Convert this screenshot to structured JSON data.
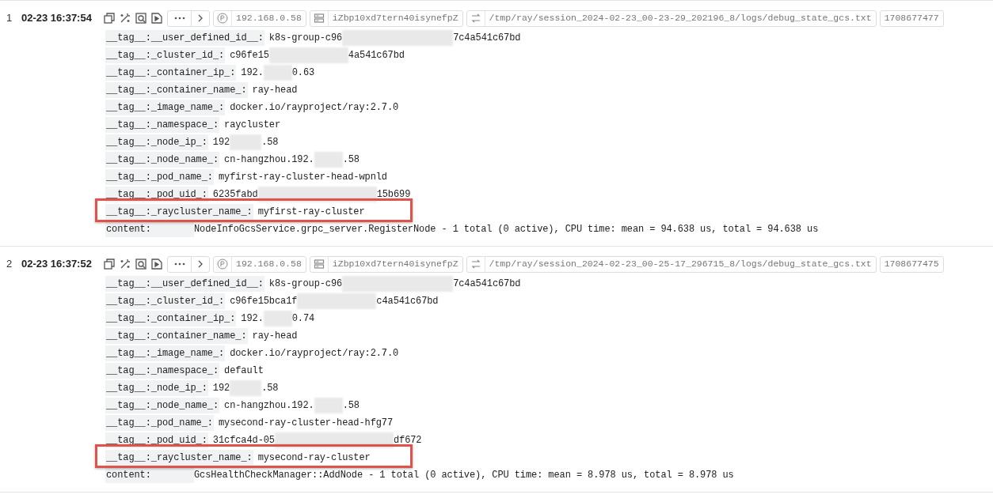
{
  "records": [
    {
      "number": "1",
      "time": "02-23 16:37:54",
      "chips": [
        {
          "kind": "ip",
          "text": "192.168.0.58"
        },
        {
          "kind": "host",
          "text": "iZbp10xd7tern40isynefpZ"
        },
        {
          "kind": "path",
          "text": "/tmp/ray/session_2024-02-23_00-23-29_202196_8/logs/debug_state_gcs.txt"
        },
        {
          "kind": "plain",
          "text": "1708677477"
        }
      ],
      "fields": [
        {
          "key": "__tag__:__user_defined_id__:",
          "value_start": "k8s-group-c96",
          "redacted": true,
          "value_end": "7c4a541c67bd",
          "highlighted": false
        },
        {
          "key": "__tag__:_cluster_id_:",
          "value_start": "c96fe15",
          "redacted": true,
          "value_end": "4a541c67bd",
          "highlighted": false
        },
        {
          "key": "__tag__:_container_ip_:",
          "value_start": "192.",
          "redacted": true,
          "value_end": "0.63",
          "highlighted": false
        },
        {
          "key": "__tag__:_container_name_:",
          "value_start": "ray-head",
          "highlighted": false
        },
        {
          "key": "__tag__:_image_name_:",
          "value_start": "docker.io/rayproject/ray:2.7.0",
          "highlighted": false
        },
        {
          "key": "__tag__:_namespace_:",
          "value_start": "raycluster",
          "highlighted": false
        },
        {
          "key": "__tag__:_node_ip_:",
          "value_start": "192",
          "redacted": true,
          "value_end": ".58",
          "highlighted": false
        },
        {
          "key": "__tag__:_node_name_:",
          "value_start": "cn-hangzhou.192.",
          "redacted": true,
          "value_end": ".58",
          "highlighted": false
        },
        {
          "key": "__tag__:_pod_name_:",
          "value_start": "myfirst-ray-cluster-head-wpnld",
          "highlighted": false
        },
        {
          "key": "__tag__:_pod_uid_:",
          "value_start": "6235fabd",
          "redacted": true,
          "value_end": "15b699",
          "highlighted": false
        },
        {
          "key": "__tag__:_raycluster_name_:",
          "value_start": "myfirst-ray-cluster",
          "highlighted": true
        }
      ],
      "content_key": "content:",
      "content": "NodeInfoGcsService.grpc_server.RegisterNode - 1 total (0 active), CPU time: mean = 94.638 us, total = 94.638 us"
    },
    {
      "number": "2",
      "time": "02-23 16:37:52",
      "chips": [
        {
          "kind": "ip",
          "text": "192.168.0.58"
        },
        {
          "kind": "host",
          "text": "iZbp10xd7tern40isynefpZ"
        },
        {
          "kind": "path",
          "text": "/tmp/ray/session_2024-02-23_00-25-17_296715_8/logs/debug_state_gcs.txt"
        },
        {
          "kind": "plain",
          "text": "1708677475"
        }
      ],
      "fields": [
        {
          "key": "__tag__:__user_defined_id__:",
          "value_start": "k8s-group-c96",
          "redacted": true,
          "value_end": "7c4a541c67bd",
          "highlighted": false
        },
        {
          "key": "__tag__:_cluster_id_:",
          "value_start": "c96fe15bca1f",
          "redacted": true,
          "value_end": "c4a541c67bd",
          "highlighted": false
        },
        {
          "key": "__tag__:_container_ip_:",
          "value_start": "192.",
          "redacted": true,
          "value_end": "0.74",
          "highlighted": false
        },
        {
          "key": "__tag__:_container_name_:",
          "value_start": "ray-head",
          "highlighted": false
        },
        {
          "key": "__tag__:_image_name_:",
          "value_start": "docker.io/rayproject/ray:2.7.0",
          "highlighted": false
        },
        {
          "key": "__tag__:_namespace_:",
          "value_start": "default",
          "highlighted": false
        },
        {
          "key": "__tag__:_node_ip_:",
          "value_start": "192",
          "redacted": true,
          "value_end": ".58",
          "highlighted": false
        },
        {
          "key": "__tag__:_node_name_:",
          "value_start": "cn-hangzhou.192.",
          "redacted": true,
          "value_end": ".58",
          "highlighted": false
        },
        {
          "key": "__tag__:_pod_name_:",
          "value_start": "mysecond-ray-cluster-head-hfg77",
          "highlighted": false
        },
        {
          "key": "__tag__:_pod_uid_:",
          "value_start": "31cfca4d-05",
          "redacted": true,
          "value_end": "df672",
          "highlighted": false
        },
        {
          "key": "__tag__:_raycluster_name_:",
          "value_start": "mysecond-ray-cluster",
          "highlighted": true
        }
      ],
      "content_key": "content:",
      "content": "GcsHealthCheckManager::AddNode - 1 total (0 active), CPU time: mean = 8.978 us, total = 8.978 us"
    }
  ]
}
